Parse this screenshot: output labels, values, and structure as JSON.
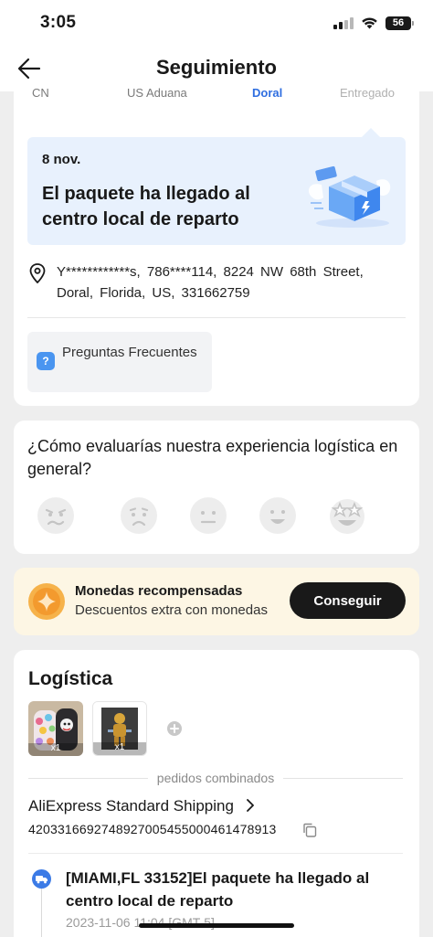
{
  "status_bar": {
    "time": "3:05",
    "battery": "56"
  },
  "header": {
    "title": "Seguimiento"
  },
  "progress_steps": [
    {
      "label": "CN",
      "state": "done"
    },
    {
      "label": "US Aduana",
      "state": "done"
    },
    {
      "label": "Doral",
      "state": "active"
    },
    {
      "label": "Entregado",
      "state": "future"
    }
  ],
  "latest_status": {
    "date": "8 nov.",
    "text": "El paquete ha llegado al centro local de reparto"
  },
  "address": {
    "text": "Y************s, 786****114, 8224 NW 68th Street, Doral, Florida, US, 331662759"
  },
  "faq": {
    "label": "Preguntas Frecuentes",
    "icon": "?"
  },
  "rating": {
    "question": "¿Cómo evaluarías nuestra experiencia logística en general?",
    "faces": [
      "angry-face-icon",
      "sad-face-icon",
      "neutral-face-icon",
      "happy-face-icon",
      "star-struck-face-icon"
    ]
  },
  "coins": {
    "title": "Monedas recompensadas",
    "subtitle": "Descuentos extra con monedas",
    "button": "Conseguir"
  },
  "logistics": {
    "title": "Logística",
    "items": [
      {
        "qty": "x1"
      },
      {
        "qty": "x1"
      }
    ],
    "combined_label": "pedidos combinados",
    "carrier": "AliExpress Standard Shipping",
    "tracking_number": "42033166927489270054550004614789​13",
    "timeline": [
      {
        "text": "[MIAMI,FL 33152]El paquete ha llegado al centro local de reparto",
        "time": "2023-11-06 11:04 [GMT-5]"
      }
    ]
  },
  "colors": {
    "accent": "#2f6ee0",
    "status_bg": "#e8f1fd",
    "coins_bg": "#fdf6e4",
    "button_dark": "#191919"
  }
}
